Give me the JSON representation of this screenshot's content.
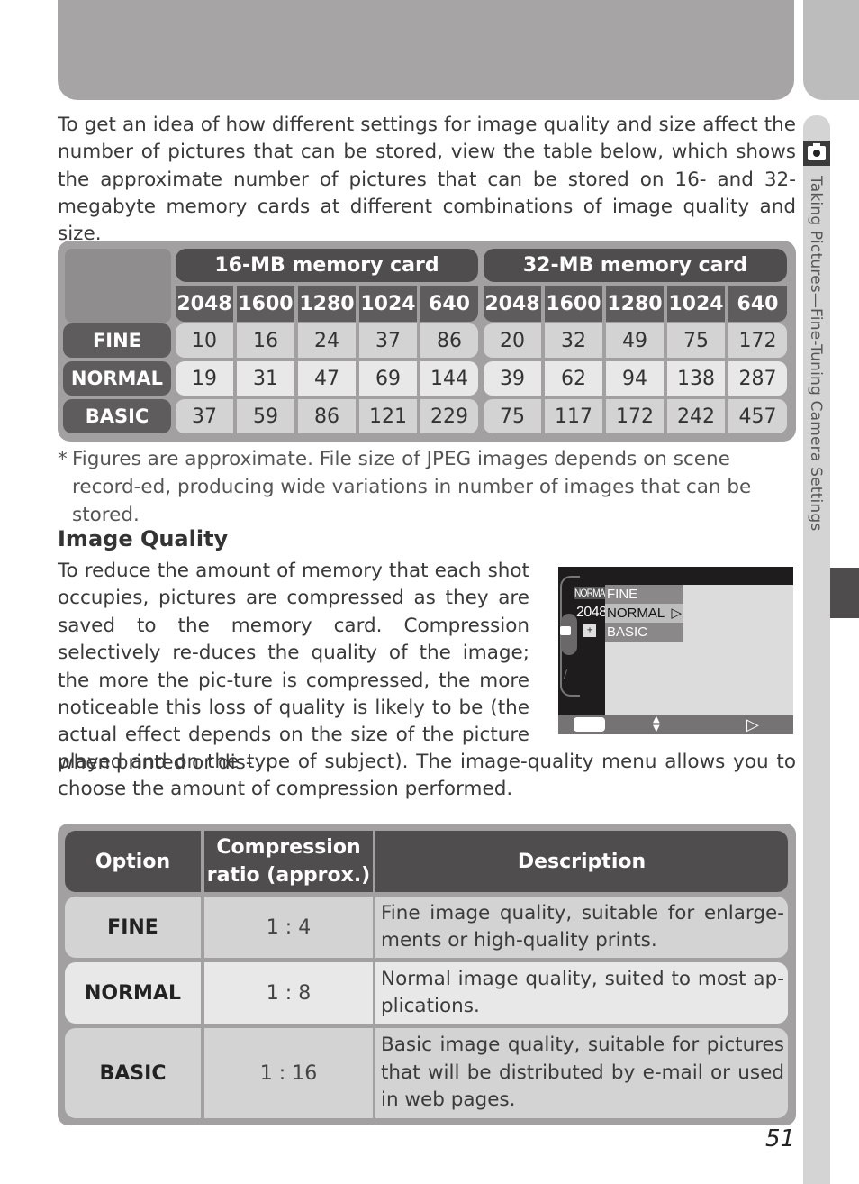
{
  "page": {
    "number": "51",
    "side_tab_title": "Taking Pictures—Fine-Tuning Camera Settings",
    "side_tab_icon": "camera-icon"
  },
  "intro": "To get an idea of how different settings for image quality and size affect the number of pictures that can be stored, view the table below, which shows the approximate number of pictures that can be stored on 16- and 32-megabyte memory cards at different combinations of image quality and size.",
  "memory_table": {
    "cards": [
      "16-MB memory card",
      "32-MB memory card"
    ],
    "sizes": [
      "2048",
      "1600",
      "1280",
      "1024",
      "640"
    ],
    "rows": [
      {
        "quality": "FINE",
        "card16": [
          "10",
          "16",
          "24",
          "37",
          "86"
        ],
        "card32": [
          "20",
          "32",
          "49",
          "75",
          "172"
        ]
      },
      {
        "quality": "NORMAL",
        "card16": [
          "19",
          "31",
          "47",
          "69",
          "144"
        ],
        "card32": [
          "39",
          "62",
          "94",
          "138",
          "287"
        ]
      },
      {
        "quality": "BASIC",
        "card16": [
          "37",
          "59",
          "86",
          "121",
          "229"
        ],
        "card32": [
          "75",
          "117",
          "172",
          "242",
          "457"
        ]
      }
    ]
  },
  "footnote": {
    "marker": "*",
    "text": "Figures are approximate.  File size of JPEG images depends on scene record-ed, producing wide variations in number of images that can be stored."
  },
  "section": {
    "title": "Image Quality",
    "body_part1": "To reduce the amount of memory that each shot occupies, pictures are compressed as they are saved to the memory card.  Compression selectively re-duces the quality of the image; the more the pic-ture is compressed, the more noticeable this loss of quality is likely to be (the actual effect depends on the size of the picture when printed or dis-",
    "body_part2": "played and on the type of subject).  The image-quality menu allows you to choose the amount of compression performed."
  },
  "camera_screen": {
    "current_quality": "NORMAL",
    "current_size": "2048",
    "menu_items": [
      {
        "label": "FINE",
        "selected": false
      },
      {
        "label": "NORMAL",
        "selected": true,
        "arrow": "▷"
      },
      {
        "label": "BASIC",
        "selected": false
      }
    ],
    "ev_icon": "±",
    "bar_updown": "▲▼",
    "bar_right": "▷"
  },
  "option_table": {
    "headers": [
      "Option",
      "Compression ratio (approx.)",
      "Description"
    ],
    "rows": [
      {
        "option": "FINE",
        "ratio": "1 : 4",
        "description": "Fine image quality, suitable for enlarge-ments or high-quality prints."
      },
      {
        "option": "NORMAL",
        "ratio": "1 : 8",
        "description": "Normal image quality, suited to most ap-plications."
      },
      {
        "option": "BASIC",
        "ratio": "1 : 16",
        "description": "Basic image quality, suitable for pictures that will be distributed by e-mail or used in web pages."
      }
    ]
  }
}
